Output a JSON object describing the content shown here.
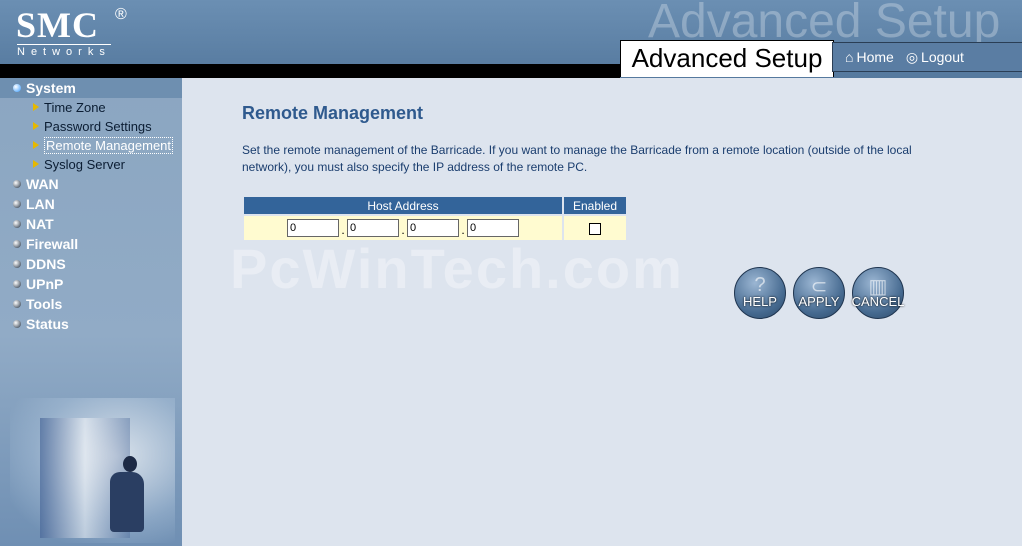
{
  "brand": {
    "logo": "SMC",
    "reg": "®",
    "subtitle": "Networks"
  },
  "header": {
    "ghost_title": "Advanced Setup",
    "title": "Advanced Setup",
    "home": "Home",
    "logout": "Logout"
  },
  "sidebar": {
    "categories": [
      {
        "label": "System",
        "active": true,
        "items": [
          "Time Zone",
          "Password Settings",
          "Remote Management",
          "Syslog Server"
        ],
        "current_item": "Remote Management"
      },
      {
        "label": "WAN"
      },
      {
        "label": "LAN"
      },
      {
        "label": "NAT"
      },
      {
        "label": "Firewall"
      },
      {
        "label": "DDNS"
      },
      {
        "label": "UPnP"
      },
      {
        "label": "Tools"
      },
      {
        "label": "Status"
      }
    ]
  },
  "main": {
    "title": "Remote Management",
    "description": "Set the remote management of the Barricade. If you want to manage the Barricade from a remote location (outside of the local network), you must also specify the IP address of the remote PC.",
    "watermark": "PcWinTech.com",
    "table": {
      "headers": [
        "Host Address",
        "Enabled"
      ],
      "ip": [
        "0",
        "0",
        "0",
        "0"
      ],
      "separator": ".",
      "enabled": false
    },
    "buttons": {
      "help": "HELP",
      "apply": "APPLY",
      "cancel": "CANCEL"
    }
  },
  "colors": {
    "header": "#5f84aa",
    "sidebar": "#8ba6c1",
    "title": "#2f5a8e",
    "table_header": "#33649a",
    "table_row": "#fffbd0"
  }
}
